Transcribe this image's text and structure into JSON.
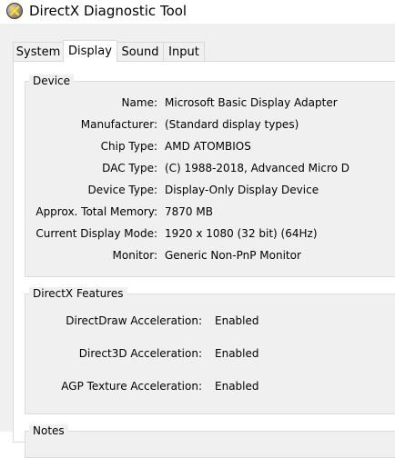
{
  "window": {
    "title": "DirectX Diagnostic Tool",
    "icon": "directx-x-logo"
  },
  "tabs": [
    {
      "label": "System",
      "active": false
    },
    {
      "label": "Display",
      "active": true
    },
    {
      "label": "Sound",
      "active": false
    },
    {
      "label": "Input",
      "active": false
    }
  ],
  "device": {
    "group_title": "Device",
    "rows": [
      {
        "label": "Name:",
        "value": "Microsoft Basic Display Adapter"
      },
      {
        "label": "Manufacturer:",
        "value": "(Standard display types)"
      },
      {
        "label": "Chip Type:",
        "value": "AMD ATOMBIOS"
      },
      {
        "label": "DAC Type:",
        "value": "(C) 1988-2018, Advanced Micro D"
      },
      {
        "label": "Device Type:",
        "value": "Display-Only Display Device"
      },
      {
        "label": "Approx. Total Memory:",
        "value": "7870 MB"
      },
      {
        "label": "Current Display Mode:",
        "value": "1920 x 1080 (32 bit) (64Hz)"
      },
      {
        "label": "Monitor:",
        "value": "Generic Non-PnP Monitor"
      }
    ]
  },
  "features": {
    "group_title": "DirectX Features",
    "rows": [
      {
        "label": "DirectDraw Acceleration:",
        "value": "Enabled"
      },
      {
        "label": "Direct3D Acceleration:",
        "value": "Enabled"
      },
      {
        "label": "AGP Texture Acceleration:",
        "value": "Enabled"
      }
    ]
  },
  "notes": {
    "group_title": "Notes"
  },
  "colors": {
    "panel_bg": "#f0f0f0",
    "tab_active_bg": "#ffffff",
    "border": "#d9d9d9"
  }
}
